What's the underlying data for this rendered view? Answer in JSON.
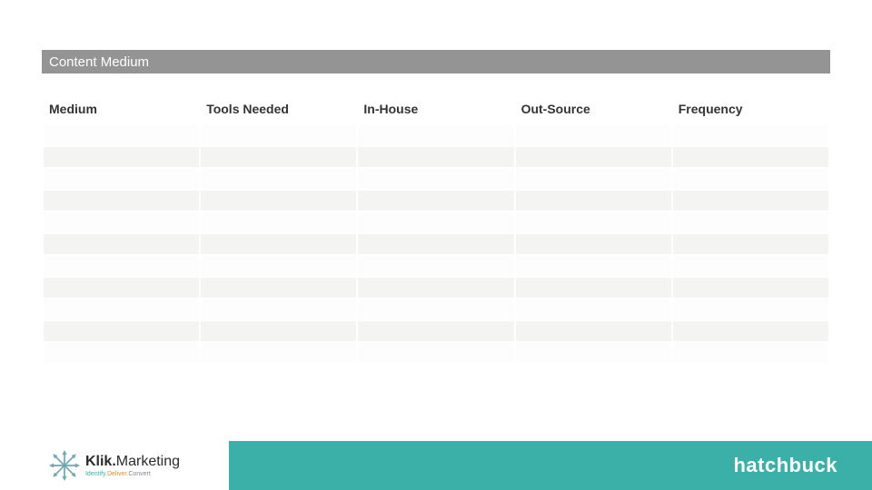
{
  "title": "Content Medium",
  "columns": [
    "Medium",
    "Tools Needed",
    "In-House",
    "Out-Source",
    "Frequency"
  ],
  "rows": [
    [
      "",
      "",
      "",
      "",
      ""
    ],
    [
      "",
      "",
      "",
      "",
      ""
    ],
    [
      "",
      "",
      "",
      "",
      ""
    ],
    [
      "",
      "",
      "",
      "",
      ""
    ],
    [
      "",
      "",
      "",
      "",
      ""
    ],
    [
      "",
      "",
      "",
      "",
      ""
    ],
    [
      "",
      "",
      "",
      "",
      ""
    ],
    [
      "",
      "",
      "",
      "",
      ""
    ],
    [
      "",
      "",
      "",
      "",
      ""
    ],
    [
      "",
      "",
      "",
      "",
      ""
    ],
    [
      "",
      "",
      "",
      "",
      ""
    ]
  ],
  "footer": {
    "left_logo": {
      "name": "Klik.Marketing",
      "bold_part": "Klik.",
      "thin_part": "Marketing",
      "tagline_a": "Identify.",
      "tagline_b": "Deliver.",
      "tagline_c": "Convert"
    },
    "right_brand": "hatchbuck"
  }
}
